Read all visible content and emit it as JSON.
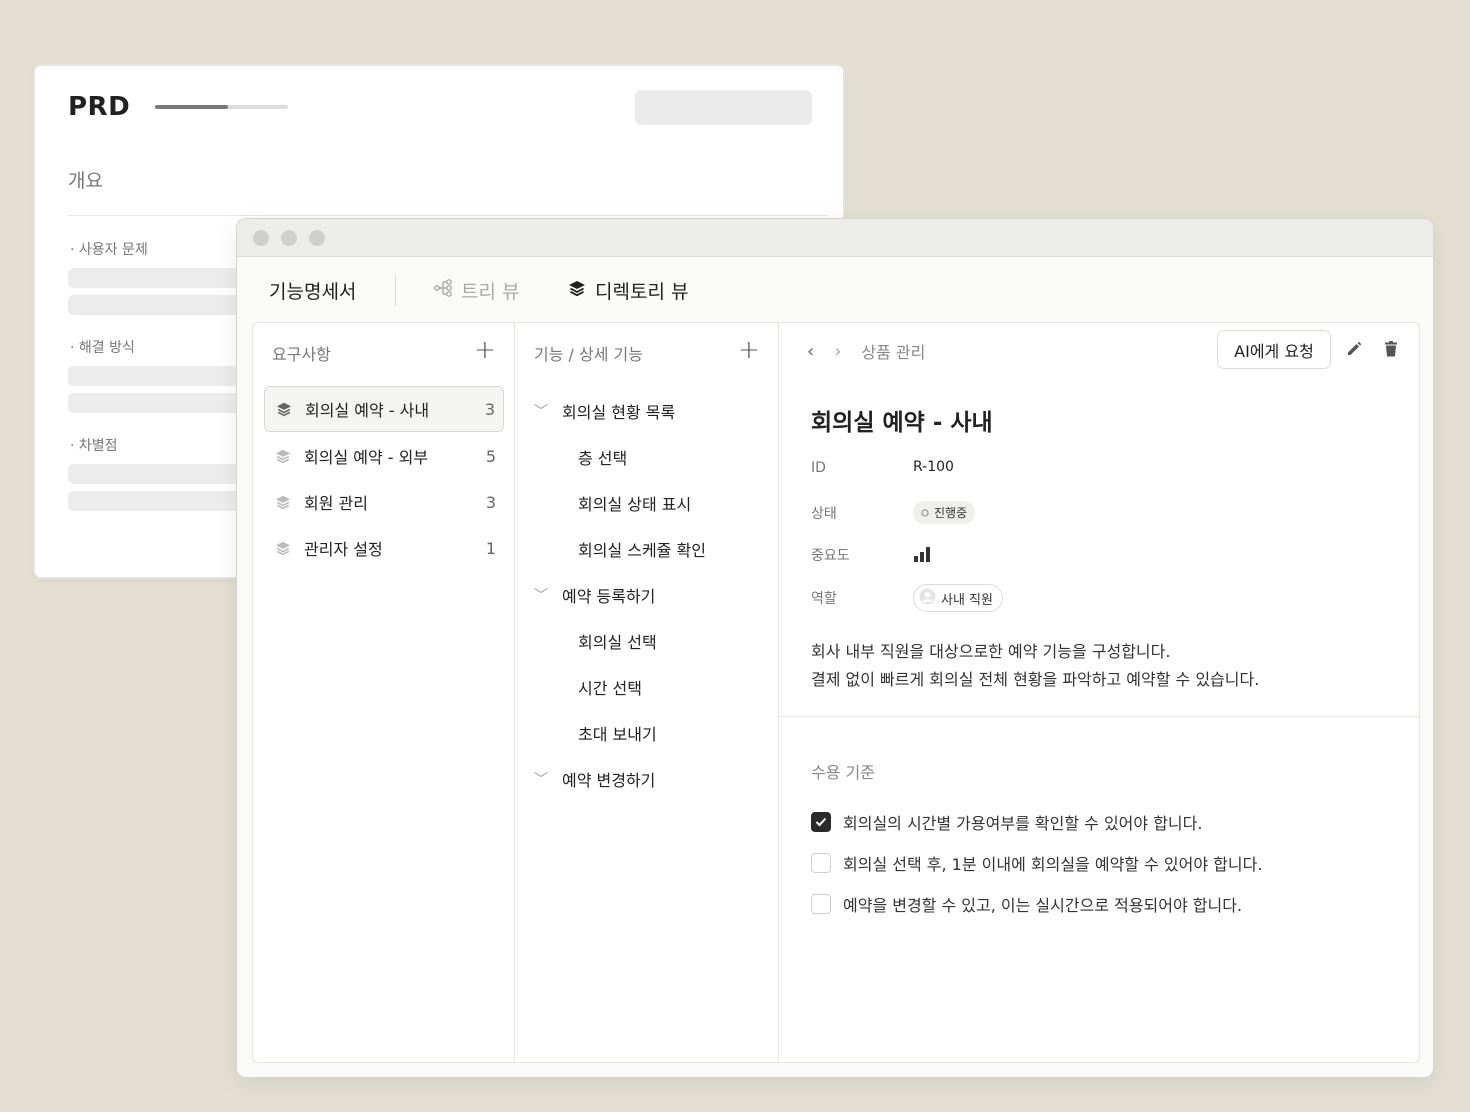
{
  "prd": {
    "title": "PRD",
    "progress": 0.55,
    "overview_label": "개요",
    "sections": [
      "· 사용자 문제",
      "· 해결 방식",
      "· 차별점"
    ]
  },
  "window": {
    "doc_title": "기능명세서",
    "tabs": [
      {
        "label": "트리 뷰",
        "icon": "tree-icon",
        "active": false
      },
      {
        "label": "디렉토리 뷰",
        "icon": "layers-icon",
        "active": true
      }
    ]
  },
  "requirements": {
    "header": "요구사항",
    "items": [
      {
        "label": "회의실 예약 - 사내",
        "count": "3",
        "active": true
      },
      {
        "label": "회의실 예약 - 외부",
        "count": "5",
        "active": false
      },
      {
        "label": "회원 관리",
        "count": "3",
        "active": false
      },
      {
        "label": "관리자 설정",
        "count": "1",
        "active": false
      }
    ]
  },
  "features": {
    "header": "기능 / 상세 기능",
    "items": [
      {
        "label": "회의실 현황 목록",
        "level": 0
      },
      {
        "label": "층 선택",
        "level": 1
      },
      {
        "label": "회의실 상태 표시",
        "level": 1
      },
      {
        "label": "회의실 스케쥴 확인",
        "level": 1
      },
      {
        "label": "예약 등록하기",
        "level": 0
      },
      {
        "label": "회의실 선택",
        "level": 1
      },
      {
        "label": "시간 선택",
        "level": 1
      },
      {
        "label": "초대 보내기",
        "level": 1
      },
      {
        "label": "예약 변경하기",
        "level": 0
      }
    ]
  },
  "detail": {
    "breadcrumb": "상품 관리",
    "ai_button": "AI에게 요청",
    "title": "회의실 예약 - 사내",
    "props": {
      "id_label": "ID",
      "id_value": "R-100",
      "status_label": "상태",
      "status_value": "진행중",
      "priority_label": "중요도",
      "priority_level": 3,
      "role_label": "역할",
      "role_value": "사내 직원"
    },
    "description": [
      "회사 내부 직원을 대상으로한 예약 기능을 구성합니다.",
      "결제 없이 빠르게 회의실 전체 현황을 파악하고 예약할 수 있습니다."
    ],
    "acceptance_header": "수용 기준",
    "acceptance": [
      {
        "label": "회의실의 시간별 가용여부를 확인할 수 있어야 합니다.",
        "checked": true
      },
      {
        "label": "회의실 선택 후, 1분 이내에 회의실을 예약할 수 있어야 합니다.",
        "checked": false
      },
      {
        "label": "예약을 변경할 수 있고, 이는 실시간으로 적용되어야 합니다.",
        "checked": false
      }
    ]
  }
}
